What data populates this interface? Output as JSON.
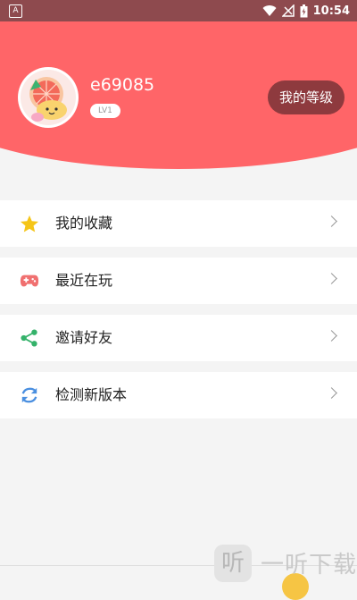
{
  "status_bar": {
    "time": "10:54",
    "left_icon": "A"
  },
  "header": {
    "username": "e69085",
    "level": "LV1",
    "level_button": "我的等级"
  },
  "menu": [
    {
      "label": "我的收藏",
      "icon": "star-icon",
      "color": "#f5c518"
    },
    {
      "label": "最近在玩",
      "icon": "gamepad-icon",
      "color": "#f07070"
    },
    {
      "label": "邀请好友",
      "icon": "share-icon",
      "color": "#34b26a"
    },
    {
      "label": "检测新版本",
      "icon": "refresh-icon",
      "color": "#4a8fe0"
    }
  ],
  "watermark": {
    "glyph": "听",
    "text": "一听下载"
  },
  "colors": {
    "header": "#ff6568",
    "status_bar": "#8e4a4e",
    "level_button": "#8e3a3e",
    "background": "#f4f4f4"
  }
}
